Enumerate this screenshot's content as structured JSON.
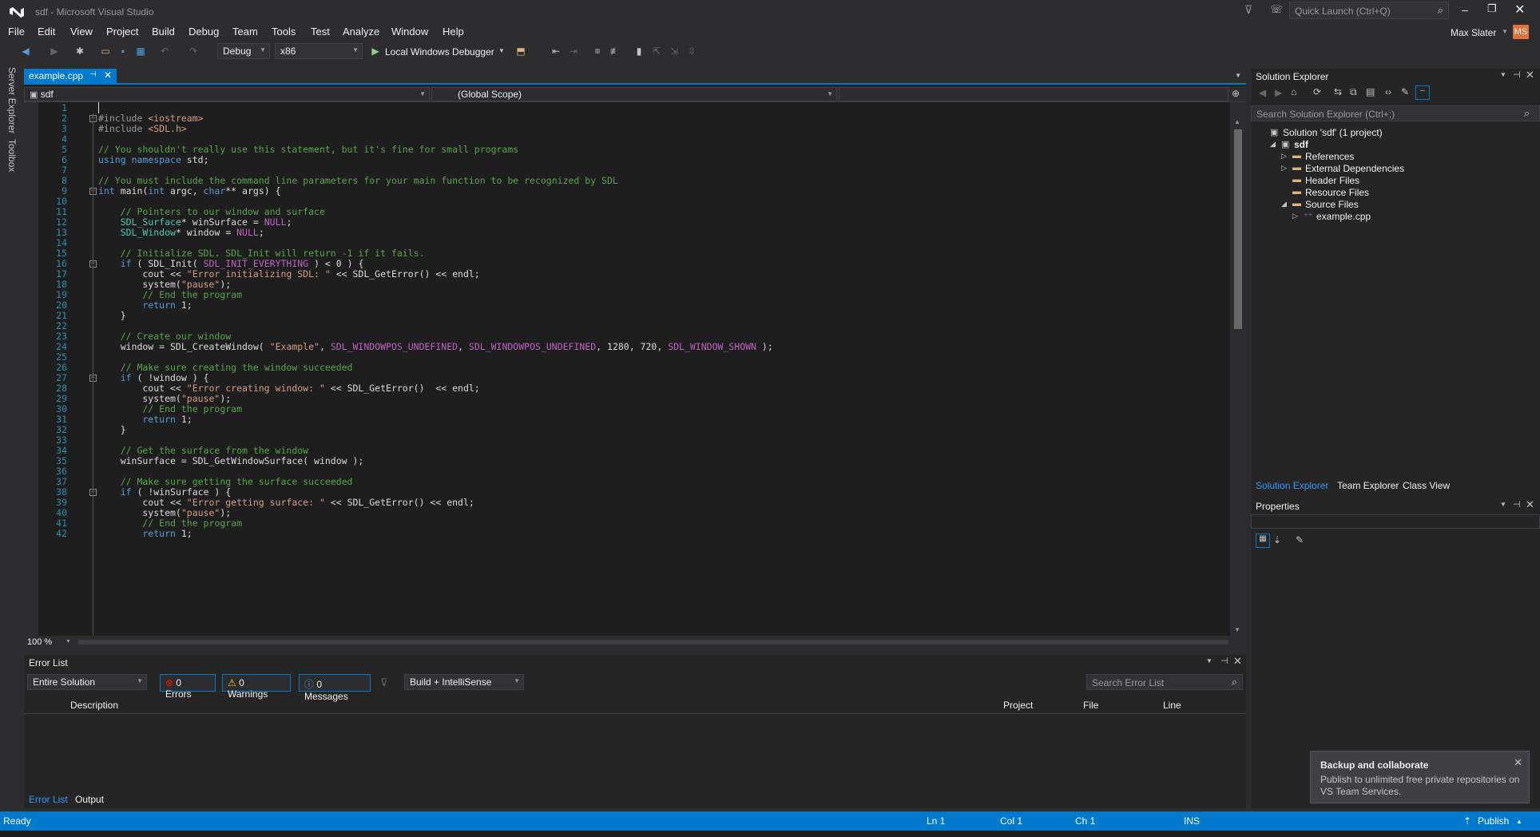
{
  "window": {
    "title": "sdf - Microsoft Visual Studio",
    "quick_launch_placeholder": "Quick Launch (Ctrl+Q)",
    "user_name": "Max Slater",
    "user_initials": "MS"
  },
  "menu": [
    "File",
    "Edit",
    "View",
    "Project",
    "Build",
    "Debug",
    "Team",
    "Tools",
    "Test",
    "Analyze",
    "Window",
    "Help"
  ],
  "toolbar": {
    "config": "Debug",
    "platform": "x86",
    "debugger": "Local Windows Debugger"
  },
  "left_strip": [
    "Server Explorer",
    "Toolbox"
  ],
  "editor": {
    "tab_name": "example.cpp",
    "nav_project": "sdf",
    "nav_scope": "(Global Scope)",
    "zoom": "100 %",
    "lines": [
      {
        "n": "1",
        "t": ""
      },
      {
        "n": "2",
        "t": "#include <iostream>",
        "cls": "pp",
        "fold": "⊟"
      },
      {
        "n": "3",
        "t": "#include <SDL.h>",
        "cls": "pp"
      },
      {
        "n": "4",
        "t": ""
      },
      {
        "n": "5",
        "t": "// You shouldn't really use this statement, but it's fine for small programs",
        "cls": "com"
      },
      {
        "n": "6",
        "t": "using namespace std;",
        "cls": "mix-using"
      },
      {
        "n": "7",
        "t": ""
      },
      {
        "n": "8",
        "t": "// You must include the command line parameters for your main function to be recognized by SDL",
        "cls": "com"
      },
      {
        "n": "9",
        "t": "int main(int argc, char** args) {",
        "cls": "mix-main",
        "fold": "⊟"
      },
      {
        "n": "10",
        "t": ""
      },
      {
        "n": "11",
        "t": "    // Pointers to our window and surface",
        "cls": "com"
      },
      {
        "n": "12",
        "t": "    SDL_Surface* winSurface = NULL;",
        "cls": "plain"
      },
      {
        "n": "13",
        "t": "    SDL_Window* window = NULL;",
        "cls": "plain"
      },
      {
        "n": "14",
        "t": ""
      },
      {
        "n": "15",
        "t": "    // Initialize SDL. SDL_Init will return -1 if it fails.",
        "cls": "com"
      },
      {
        "n": "16",
        "t": "    if ( SDL_Init( SDL_INIT_EVERYTHING ) < 0 ) {",
        "cls": "plain",
        "fold": "⊟"
      },
      {
        "n": "17",
        "t": "        cout << \"Error initializing SDL: \" << SDL_GetError() << endl;",
        "cls": "plain"
      },
      {
        "n": "18",
        "t": "        system(\"pause\");",
        "cls": "plain"
      },
      {
        "n": "19",
        "t": "        // End the program",
        "cls": "com"
      },
      {
        "n": "20",
        "t": "        return 1;",
        "cls": "plain"
      },
      {
        "n": "21",
        "t": "    }",
        "cls": "plain"
      },
      {
        "n": "22",
        "t": ""
      },
      {
        "n": "23",
        "t": "    // Create our window",
        "cls": "com"
      },
      {
        "n": "24",
        "t": "    window = SDL_CreateWindow( \"Example\", SDL_WINDOWPOS_UNDEFINED, SDL_WINDOWPOS_UNDEFINED, 1280, 720, SDL_WINDOW_SHOWN );",
        "cls": "plain"
      },
      {
        "n": "25",
        "t": ""
      },
      {
        "n": "26",
        "t": "    // Make sure creating the window succeeded",
        "cls": "com"
      },
      {
        "n": "27",
        "t": "    if ( !window ) {",
        "cls": "plain",
        "fold": "⊟"
      },
      {
        "n": "28",
        "t": "        cout << \"Error creating window: \" << SDL_GetError()  << endl;",
        "cls": "plain"
      },
      {
        "n": "29",
        "t": "        system(\"pause\");",
        "cls": "plain"
      },
      {
        "n": "30",
        "t": "        // End the program",
        "cls": "com"
      },
      {
        "n": "31",
        "t": "        return 1;",
        "cls": "plain"
      },
      {
        "n": "32",
        "t": "    }",
        "cls": "plain"
      },
      {
        "n": "33",
        "t": ""
      },
      {
        "n": "34",
        "t": "    // Get the surface from the window",
        "cls": "com"
      },
      {
        "n": "35",
        "t": "    winSurface = SDL_GetWindowSurface( window );",
        "cls": "plain"
      },
      {
        "n": "36",
        "t": ""
      },
      {
        "n": "37",
        "t": "    // Make sure getting the surface succeeded",
        "cls": "com"
      },
      {
        "n": "38",
        "t": "    if ( !winSurface ) {",
        "cls": "plain",
        "fold": "⊟"
      },
      {
        "n": "39",
        "t": "        cout << \"Error getting surface: \" << SDL_GetError() << endl;",
        "cls": "plain"
      },
      {
        "n": "40",
        "t": "        system(\"pause\");",
        "cls": "plain"
      },
      {
        "n": "41",
        "t": "        // End the program",
        "cls": "com"
      },
      {
        "n": "42",
        "t": "        return 1;",
        "cls": "plain"
      }
    ]
  },
  "error_list": {
    "title": "Error List",
    "scope": "Entire Solution",
    "errors": "0 Errors",
    "warnings": "0 Warnings",
    "messages": "0 Messages",
    "build_filter": "Build + IntelliSense",
    "search_placeholder": "Search Error List",
    "columns": [
      "Description",
      "Project",
      "File",
      "Line"
    ],
    "bottom_tabs": [
      "Error List",
      "Output"
    ]
  },
  "solution_explorer": {
    "title": "Solution Explorer",
    "search_placeholder": "Search Solution Explorer (Ctrl+;)",
    "tree": [
      {
        "label": "Solution 'sdf' (1 project)",
        "level": 0,
        "arrow": ""
      },
      {
        "label": "sdf",
        "level": 1,
        "arrow": "◢",
        "bold": true
      },
      {
        "label": "References",
        "level": 2,
        "arrow": "▷"
      },
      {
        "label": "External Dependencies",
        "level": 2,
        "arrow": "▷"
      },
      {
        "label": "Header Files",
        "level": 2,
        "arrow": ""
      },
      {
        "label": "Resource Files",
        "level": 2,
        "arrow": ""
      },
      {
        "label": "Source Files",
        "level": 2,
        "arrow": "◢"
      },
      {
        "label": "example.cpp",
        "level": 3,
        "arrow": "▷"
      }
    ],
    "bottom_tabs": [
      "Solution Explorer",
      "Team Explorer",
      "Class View"
    ]
  },
  "properties": {
    "title": "Properties"
  },
  "toast": {
    "title": "Backup and collaborate",
    "body": "Publish to unlimited free private repositories on VS Team Services."
  },
  "status": {
    "state": "Ready",
    "line": "Ln 1",
    "col": "Col 1",
    "ch": "Ch 1",
    "mode": "INS",
    "publish": "Publish"
  },
  "colors": {
    "accent": "#007acc",
    "background": "#2d2d30",
    "editor_bg": "#1e1e1e"
  }
}
